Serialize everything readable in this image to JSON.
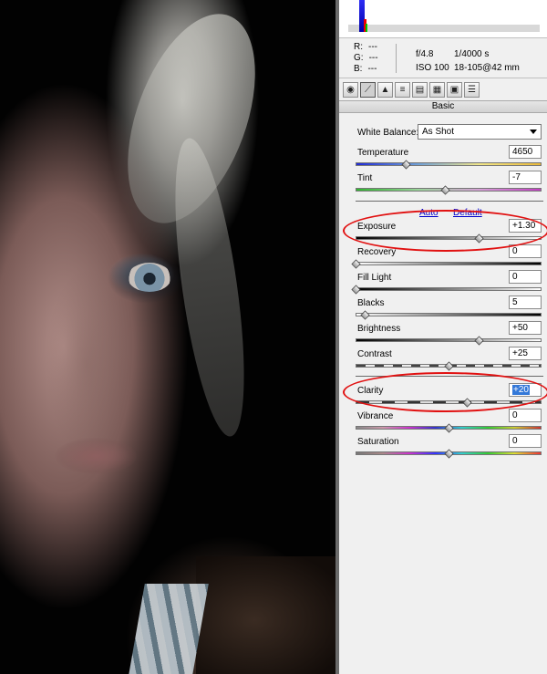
{
  "histogram": {
    "readout": {
      "r": "---",
      "g": "---",
      "b": "---"
    }
  },
  "exif": {
    "aperture": "f/4.8",
    "shutter": "1/4000 s",
    "iso": "ISO 100",
    "lens": "18-105@42 mm"
  },
  "toolbar": {
    "icons": [
      "basic-camera-icon",
      "tone-curve-icon",
      "detail-icon",
      "hsl-icon",
      "split-toning-icon",
      "lens-icon",
      "camera-calibration-icon",
      "presets-icon"
    ]
  },
  "panel": {
    "title": "Basic",
    "white_balance": {
      "label": "White Balance:",
      "value": "As Shot"
    },
    "auto_label": "Auto",
    "default_label": "Default",
    "controls": {
      "temperature": {
        "label": "Temperature",
        "value": "4650",
        "level": 0.27
      },
      "tint": {
        "label": "Tint",
        "value": "-7",
        "level": 0.48
      },
      "exposure": {
        "label": "Exposure",
        "value": "+1.30",
        "level": 0.66
      },
      "recovery": {
        "label": "Recovery",
        "value": "0",
        "level": 0.0
      },
      "fill_light": {
        "label": "Fill Light",
        "value": "0",
        "level": 0.0
      },
      "blacks": {
        "label": "Blacks",
        "value": "5",
        "level": 0.05
      },
      "brightness": {
        "label": "Brightness",
        "value": "+50",
        "level": 0.66
      },
      "contrast": {
        "label": "Contrast",
        "value": "+25",
        "level": 0.5
      },
      "clarity": {
        "label": "Clarity",
        "value": "+20",
        "level": 0.6
      },
      "vibrance": {
        "label": "Vibrance",
        "value": "0",
        "level": 0.5
      },
      "saturation": {
        "label": "Saturation",
        "value": "0",
        "level": 0.5
      }
    }
  },
  "annotations": {
    "highlight_color": "#e11111"
  }
}
